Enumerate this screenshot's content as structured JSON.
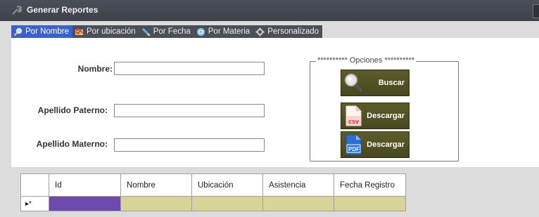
{
  "window": {
    "title": "Generar Reportes",
    "icon": "wrench-icon"
  },
  "tabs": [
    {
      "label": "Por Nombre",
      "icon": "magnifier-icon",
      "active": true
    },
    {
      "label": "Por ubicación",
      "icon": "map-icon",
      "active": false
    },
    {
      "label": "Por Fecha",
      "icon": "pencil-icon",
      "active": false
    },
    {
      "label": "Por Materia",
      "icon": "book-icon",
      "active": false
    },
    {
      "label": "Personalizado",
      "icon": "gear-icon",
      "active": false
    }
  ],
  "form": {
    "nombre_label": "Nombre:",
    "nombre_value": "",
    "apellido_paterno_label": "Apellido Paterno:",
    "apellido_paterno_value": "",
    "apellido_materno_label": "Apellido Materno:",
    "apellido_materno_value": ""
  },
  "opciones": {
    "legend": "********** Opciones **********",
    "buscar_label": "Buscar",
    "descargar_csv_label": "Descargar",
    "csv_icon_text": "csv",
    "descargar_pdf_label": "Descargar",
    "pdf_icon_text": "PDF"
  },
  "grid": {
    "columns": [
      "Id",
      "Nombre",
      "Ubicación",
      "Asistencia",
      "Fecha Registro"
    ],
    "new_row_marker": "▸*"
  },
  "colors": {
    "toolbar": "#4b4f58",
    "active_tab": "#3c62c8",
    "option_button": "#55552a",
    "new_row": "#d7d49a",
    "selected_cell": "#6e4aaa"
  }
}
